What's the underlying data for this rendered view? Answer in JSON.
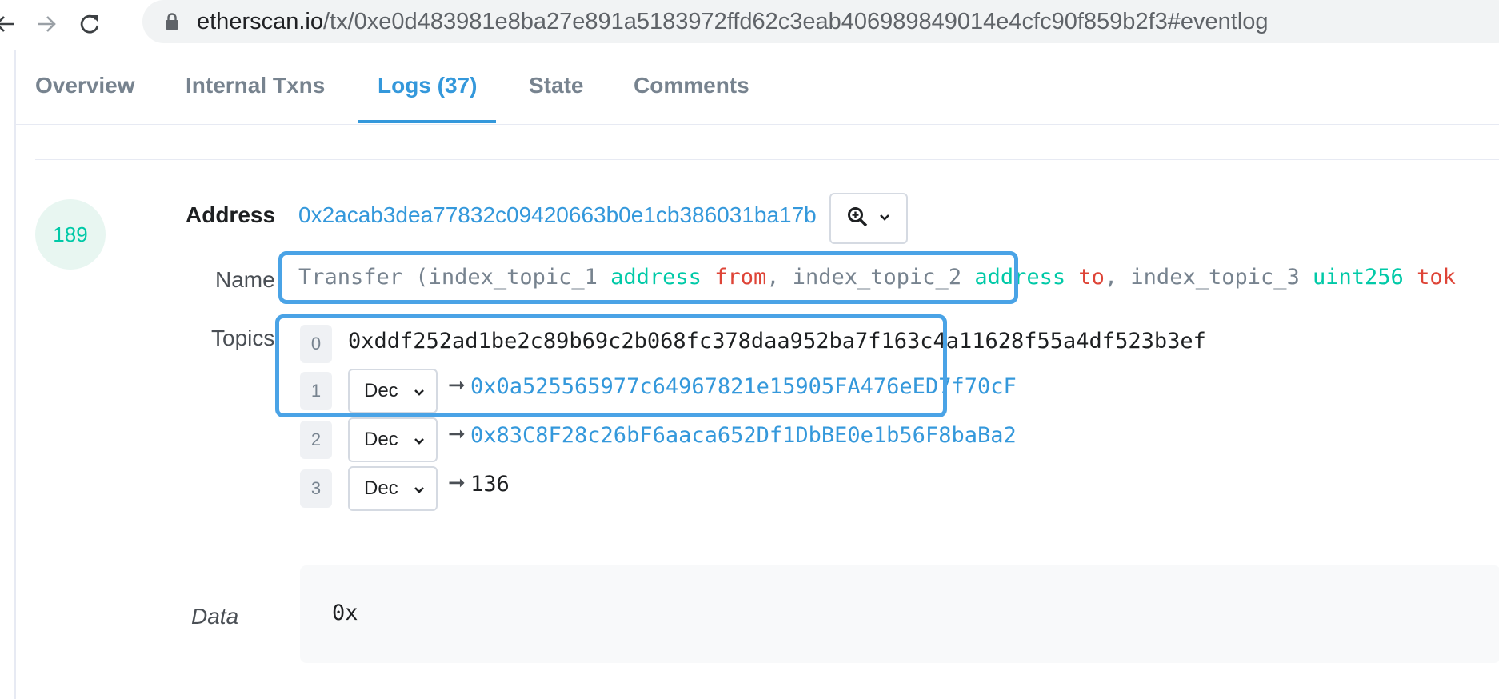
{
  "browser": {
    "url_host": "etherscan.io",
    "url_rest": "/tx/0xe0d483981e8ba27e891a5183972ffd62c3eab406989849014e4cfc90f859b2f3#eventlog"
  },
  "tabs": [
    {
      "label": "Overview"
    },
    {
      "label": "Internal Txns"
    },
    {
      "label": "Logs (37)"
    },
    {
      "label": "State"
    },
    {
      "label": "Comments"
    }
  ],
  "log": {
    "index": "189",
    "address_label": "Address",
    "address": "0x2acab3dea77832c09420663b0e1cb386031ba17b",
    "name_label": "Name",
    "signature": {
      "fn": "Transfer (",
      "p1_name": "index_topic_1 ",
      "p1_type": "address",
      "p1_var": "from",
      "sep1": ", ",
      "p2_name": "index_topic_2 ",
      "p2_type": "address",
      "p2_var": "to",
      "sep2": ", ",
      "p3_name": "index_topic_3 ",
      "p3_type": "uint256",
      "p3_var": "tok"
    },
    "topics_label": "Topics",
    "topics": [
      {
        "idx": "0",
        "value": "0xddf252ad1be2c89b69c2b068fc378daa952ba7f163c4a11628f55a4df523b3ef"
      },
      {
        "idx": "1",
        "format": "Dec",
        "value": "0x0a525565977c64967821e15905FA476eED7f70cF"
      },
      {
        "idx": "2",
        "format": "Dec",
        "value": "0x83C8F28c26bF6aaca652Df1DbBE0e1b56F8baBa2"
      },
      {
        "idx": "3",
        "format": "Dec",
        "value": "136"
      }
    ],
    "data_label": "Data",
    "data": "0x"
  },
  "colors": {
    "link": "#3498db",
    "type": "#00c9a7",
    "variable": "#de4437",
    "highlight": "#4aa3e6"
  }
}
